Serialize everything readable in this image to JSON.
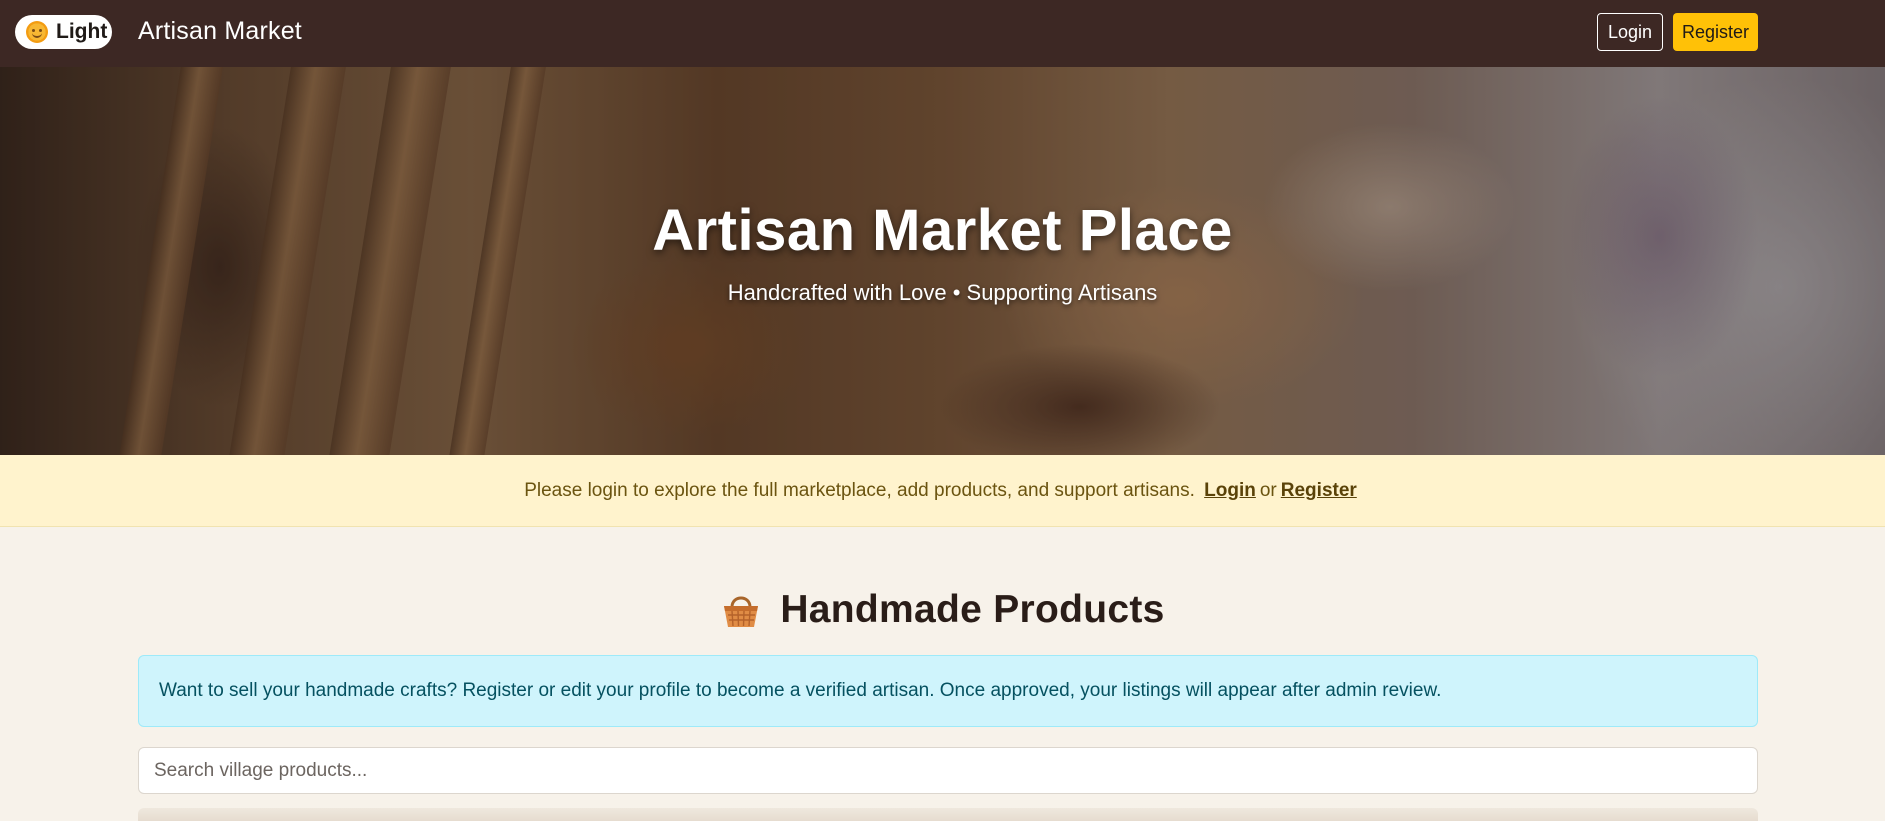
{
  "navbar": {
    "theme_toggle_label": "Light",
    "brand": "Artisan Market",
    "login_label": "Login",
    "register_label": "Register"
  },
  "hero": {
    "title": "Artisan Market Place",
    "subtitle": "Handcrafted with Love • Supporting Artisans"
  },
  "login_notice": {
    "text": "Please login to explore the full marketplace, add products, and support artisans.",
    "login_link": "Login",
    "or_text": "or",
    "register_link": "Register"
  },
  "products": {
    "heading": "Handmade Products",
    "heading_icon": "basket-icon",
    "info_text": "Want to sell your handmade crafts? Register or edit your profile to become a verified artisan. Once approved, your listings will appear after admin review.",
    "search_placeholder": "Search village products..."
  },
  "colors": {
    "navbar_bg": "#3d2824",
    "accent_register": "#ffc107",
    "notice_bg": "#fff3cd",
    "info_bg": "#cff4fc",
    "page_bg": "#f7f2ea"
  }
}
